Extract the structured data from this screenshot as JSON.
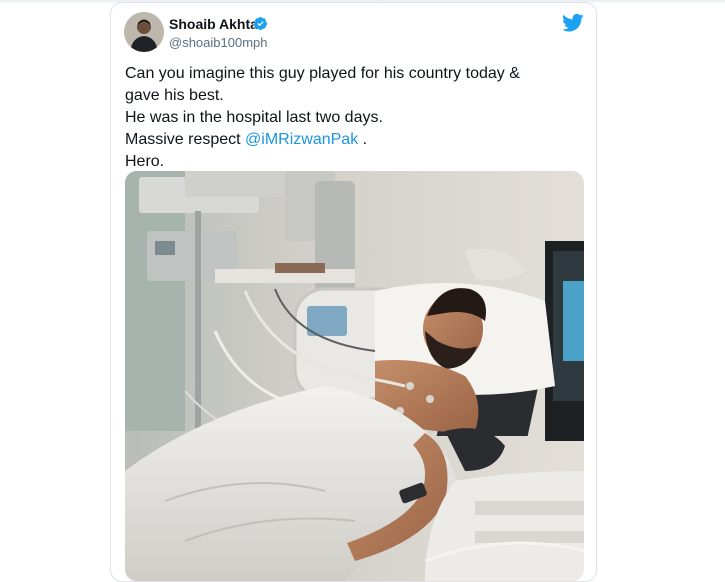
{
  "tweet": {
    "author_name": "Shoaib Akhtar",
    "author_handle": "@shoaib100mph",
    "verified": true,
    "text_lines": [
      "Can you imagine this guy played for his country today &",
      "gave his best.",
      "He was in the hospital last two days."
    ],
    "respect_prefix": "Massive respect ",
    "mention": "@iMRizwanPak",
    "respect_suffix": " .",
    "closing": "Hero."
  },
  "icons": {
    "verified": "verified-badge-icon",
    "platform": "twitter-bird-icon"
  },
  "colors": {
    "link": "#1b95e0",
    "twitter_blue": "#1da1f2",
    "text": "#0f1419",
    "secondary_text": "#5b7083"
  }
}
